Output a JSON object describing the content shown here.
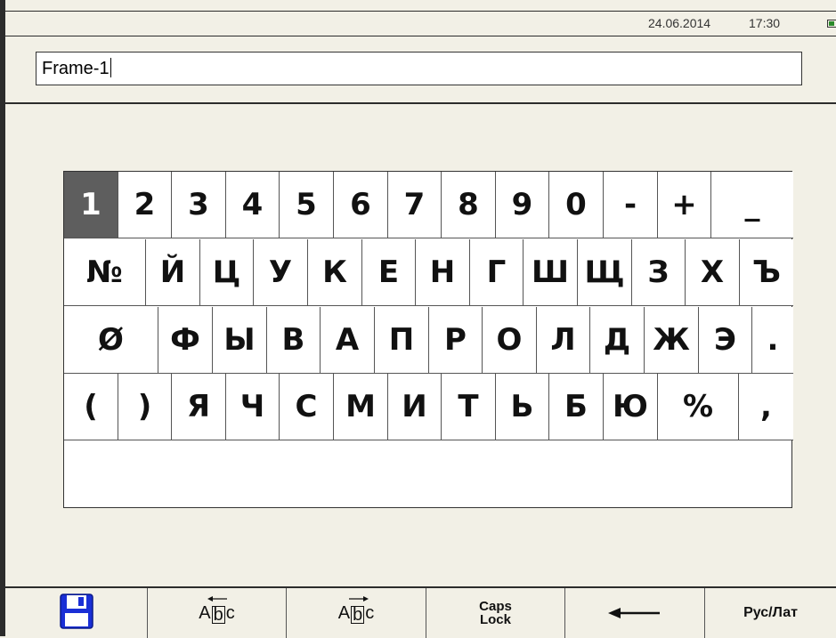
{
  "status": {
    "date": "24.06.2014",
    "time": "17:30",
    "battery_icon": "battery-icon"
  },
  "input": {
    "value": "Frame-1"
  },
  "keyboard": {
    "selected_key": "1",
    "rows": [
      [
        "1",
        "2",
        "3",
        "4",
        "5",
        "6",
        "7",
        "8",
        "9",
        "0",
        "-",
        "+",
        "_"
      ],
      [
        "№",
        "Й",
        "Ц",
        "У",
        "К",
        "Е",
        "Н",
        "Г",
        "Ш",
        "Щ",
        "З",
        "Х",
        "Ъ"
      ],
      [
        "Ø",
        "Ф",
        "Ы",
        "В",
        "А",
        "П",
        "Р",
        "О",
        "Л",
        "Д",
        "Ж",
        "Э",
        "."
      ],
      [
        "(",
        ")",
        "Я",
        "Ч",
        "С",
        "М",
        "И",
        "Т",
        "Ь",
        "Б",
        "Ю",
        "%",
        ","
      ]
    ]
  },
  "toolbar": {
    "save_icon": "floppy-disk-icon",
    "cursor_left": {
      "a": "A",
      "b": "b",
      "c": "c",
      "icon": "cursor-left-icon"
    },
    "cursor_right": {
      "a": "A",
      "b": "b",
      "c": "c",
      "icon": "cursor-right-icon"
    },
    "caps_line1": "Caps",
    "caps_line2": "Lock",
    "backspace_icon": "backspace-arrow-icon",
    "language": "Рус/Лат"
  },
  "colors": {
    "background": "#f2f0e6",
    "selected_key": "#5e5e5e",
    "save_icon": "#1a2fd6"
  }
}
